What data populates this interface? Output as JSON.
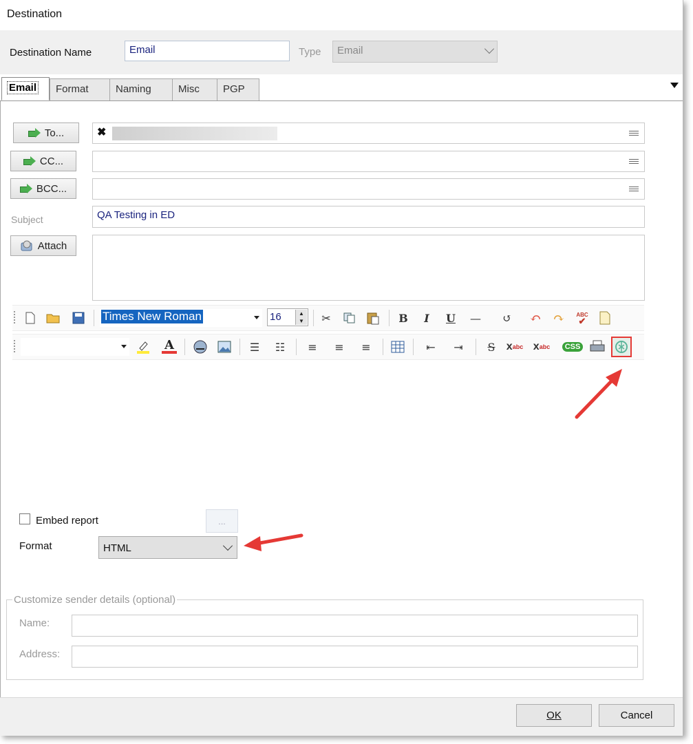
{
  "window": {
    "title": "Destination"
  },
  "header": {
    "name_label": "Destination Name",
    "name_value": "Email",
    "type_label": "Type",
    "type_value": "Email"
  },
  "tabs": [
    {
      "label": "Email",
      "active": true
    },
    {
      "label": "Format"
    },
    {
      "label": "Naming"
    },
    {
      "label": "Misc"
    },
    {
      "label": "PGP"
    }
  ],
  "recipients": {
    "to_label": "To...",
    "cc_label": "CC...",
    "bcc_label": "BCC...",
    "subject_label": "Subject",
    "subject_value": "QA Testing in ED",
    "attach_label": "Attach"
  },
  "editor_toolbar": {
    "font_name": "Times New Roman",
    "font_size": "16",
    "css_label": "CSS",
    "spell_label": "ABC"
  },
  "options": {
    "embed_label": "Embed report",
    "dots_label": "...",
    "format_label": "Format",
    "format_value": "HTML"
  },
  "sender": {
    "group_title": "Customize sender details (optional)",
    "name_label": "Name:",
    "address_label": "Address:"
  },
  "footer": {
    "ok_label": "OK",
    "cancel_label": "Cancel"
  },
  "colors": {
    "accent_arrow": "#e53935",
    "green_arrow": "#4caf50"
  }
}
